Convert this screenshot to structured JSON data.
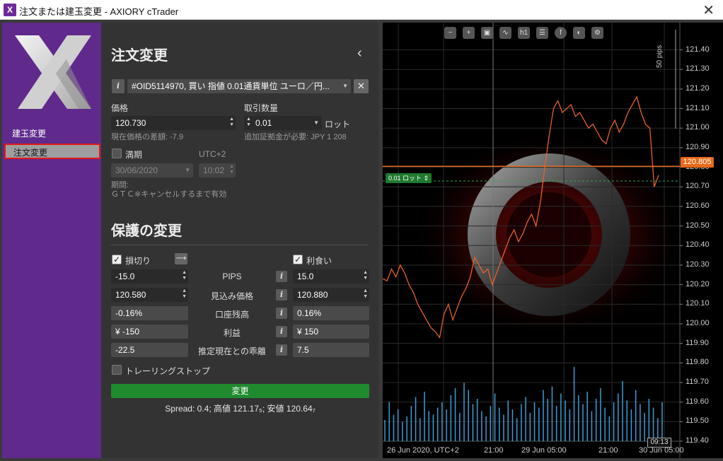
{
  "window": {
    "icon_letter": "X",
    "title": "注文または建玉変更 - AXIORY cTrader",
    "close_glyph": "✕"
  },
  "sidebar": {
    "items": [
      {
        "label": "建玉変更",
        "active": false
      },
      {
        "label": "注文変更",
        "active": true
      }
    ]
  },
  "form": {
    "heading": "注文変更",
    "collapse_glyph": "‹",
    "info_glyph": "i",
    "order_select": "#OID5114970, 買い 指値 0.01通貨単位 ユーロ／円...",
    "clear_glyph": "✕",
    "price_label": "価格",
    "price_value": "120.730",
    "price_diff": "現在価格の差額: -7.9",
    "qty_label": "取引数量",
    "qty_value": "0.01",
    "qty_unit": "ロット",
    "margin_note": "追加証拠金が必要: JPY 1 208",
    "expiry_label": "満期",
    "expiry_checked": false,
    "tz_label": "UTC+2",
    "expiry_date": "30/06/2020",
    "expiry_time": "10:02",
    "period_label": "期間:",
    "period_value": "ＧＴＣ※キャンセルするまで有効"
  },
  "protection": {
    "heading": "保護の変更",
    "stop_loss": {
      "label": "損切り",
      "checked": true,
      "arrow_glyph": "⟶"
    },
    "take_profit": {
      "label": "利食い",
      "checked": true
    },
    "rows": [
      {
        "label": "PIPS",
        "sl": "-15.0",
        "tp": "15.0",
        "spinner": true
      },
      {
        "label": "見込み価格",
        "sl": "120.580",
        "tp": "120.880",
        "spinner": true
      },
      {
        "label": "口座残高",
        "sl": "-0.16%",
        "tp": "0.16%",
        "spinner": false
      },
      {
        "label": "利益",
        "sl": "¥ -150",
        "tp": "¥ 150",
        "spinner": false
      },
      {
        "label": "推定現在との乖離",
        "sl": "-22.5",
        "tp": "7.5",
        "spinner": false
      }
    ],
    "trailing_label": "トレーリングストップ",
    "trailing_checked": false,
    "submit_label": "変更",
    "spread_line": "Spread: 0.4; 高値 121.17₅; 安値 120.64₇"
  },
  "chart_toolbar": [
    "zoom-out-icon",
    "zoom-in-icon",
    "screenshot-icon",
    "indicator-icon",
    "timeframe-icon",
    "list-icon",
    "facebook-icon",
    "share-icon",
    "settings-icon"
  ],
  "chart_toolbar_timeframe": "h1",
  "chart_data": {
    "type": "line",
    "title": "",
    "y_ticks": [
      "121.40",
      "121.30",
      "121.20",
      "121.10",
      "121.00",
      "120.90",
      "120.80",
      "120.70",
      "120.60",
      "120.50",
      "120.40",
      "120.30",
      "120.20",
      "120.10",
      "120.00",
      "119.90",
      "119.80",
      "119.70",
      "119.60",
      "119.50",
      "119.40"
    ],
    "ylim": [
      119.4,
      121.42
    ],
    "x_ticks": [
      "26 Jun 2020, UTC+2",
      "21:00",
      "29 Jun 05:00",
      "21:00",
      "30 Jun 05:00"
    ],
    "current_price_label": "120.805",
    "current_price": 120.805,
    "order_price": 120.73,
    "order_tag": "0.01 ロット",
    "pips_label": "50 pips",
    "crosshair_time": "09:13",
    "colors": {
      "price_line": "#e8622a",
      "order_line": "#2ea44f",
      "volume": "#3a9fd8",
      "current": "#e86a1a"
    },
    "prices": [
      120.23,
      120.22,
      120.28,
      120.24,
      120.3,
      120.26,
      120.2,
      120.16,
      120.1,
      120.06,
      120.02,
      119.98,
      119.96,
      119.93,
      120.05,
      120.1,
      120.02,
      120.08,
      120.14,
      120.18,
      120.24,
      120.34,
      120.3,
      120.26,
      120.28,
      120.2,
      120.26,
      120.32,
      120.38,
      120.44,
      120.48,
      120.42,
      120.46,
      120.52,
      120.56,
      120.5,
      120.62,
      120.8,
      120.96,
      121.1,
      121.14,
      121.08,
      121.1,
      121.12,
      121.06,
      121.08,
      121.04,
      121.0,
      121.02,
      120.98,
      120.94,
      120.92,
      121.0,
      121.04,
      120.98,
      121.02,
      121.08,
      121.12,
      121.16,
      121.08,
      121.02,
      121.0,
      120.7,
      120.76
    ],
    "volume": [
      12,
      22,
      15,
      18,
      11,
      14,
      20,
      25,
      13,
      28,
      17,
      15,
      19,
      22,
      18,
      26,
      30,
      16,
      33,
      29,
      21,
      24,
      17,
      14,
      20,
      27,
      19,
      15,
      23,
      18,
      13,
      21,
      25,
      16,
      22,
      19,
      29,
      24,
      31,
      20,
      27,
      23,
      18,
      42,
      26,
      21,
      28,
      17,
      24,
      30,
      19,
      14,
      22,
      27,
      34,
      23,
      18,
      29,
      21,
      16,
      24,
      19,
      13,
      22
    ]
  }
}
